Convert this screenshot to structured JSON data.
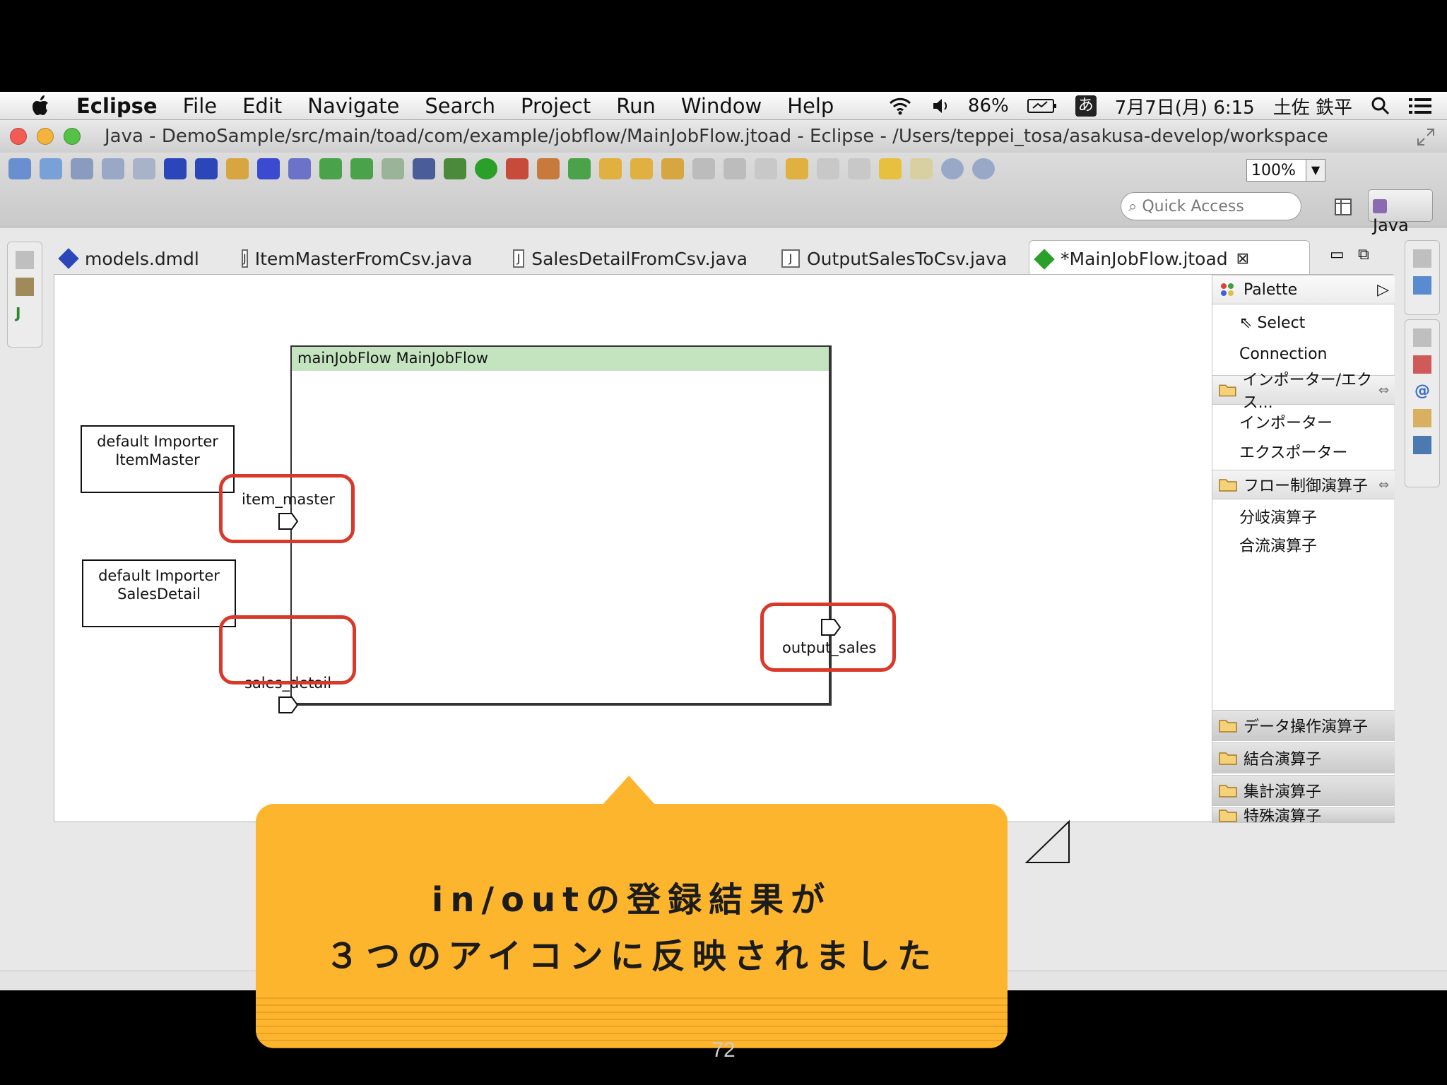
{
  "menubar": {
    "app": "Eclipse",
    "menus": [
      "File",
      "Edit",
      "Navigate",
      "Search",
      "Project",
      "Run",
      "Window",
      "Help"
    ],
    "battery": "86%",
    "ime": "あ",
    "datetime": "7月7日(月) 6:15",
    "user": "土佐 鉄平"
  },
  "window": {
    "title": "Java - DemoSample/src/main/toad/com/example/jobflow/MainJobFlow.jtoad - Eclipse - /Users/teppei_tosa/asakusa-develop/workspace"
  },
  "toolbar": {
    "zoom": "100%",
    "quick_access_placeholder": "Quick Access",
    "perspective": "Java"
  },
  "tabs": [
    {
      "label": "models.dmdl"
    },
    {
      "label": "ItemMasterFromCsv.java"
    },
    {
      "label": "SalesDetailFromCsv.java"
    },
    {
      "label": "OutputSalesToCsv.java"
    },
    {
      "label": "*MainJobFlow.jtoad",
      "active": true
    }
  ],
  "diagram": {
    "importer1": {
      "line1": "default Importer",
      "line2": "ItemMaster"
    },
    "importer2": {
      "line1": "default Importer",
      "line2": "SalesDetail"
    },
    "flow_header": "mainJobFlow MainJobFlow",
    "ports": {
      "in1": "item_master",
      "in2": "sales_detail",
      "out1": "output_sales"
    },
    "highlight_color": "#d9392a"
  },
  "palette": {
    "title": "Palette",
    "tools": [
      "Select",
      "Connection"
    ],
    "drawers": [
      {
        "label": "インポーター/エクス...",
        "items": [
          "インポーター",
          "エクスポーター"
        ]
      },
      {
        "label": "フロー制御演算子",
        "items": [
          "分岐演算子",
          "合流演算子"
        ]
      }
    ],
    "collapsed_drawers": [
      "データ操作演算子",
      "結合演算子",
      "集計演算子",
      "特殊演算子"
    ]
  },
  "callout": {
    "line1": "in/outの登録結果が",
    "line2": "３つのアイコンに反映されました",
    "color": "#fdb52e"
  },
  "page_number": "72"
}
